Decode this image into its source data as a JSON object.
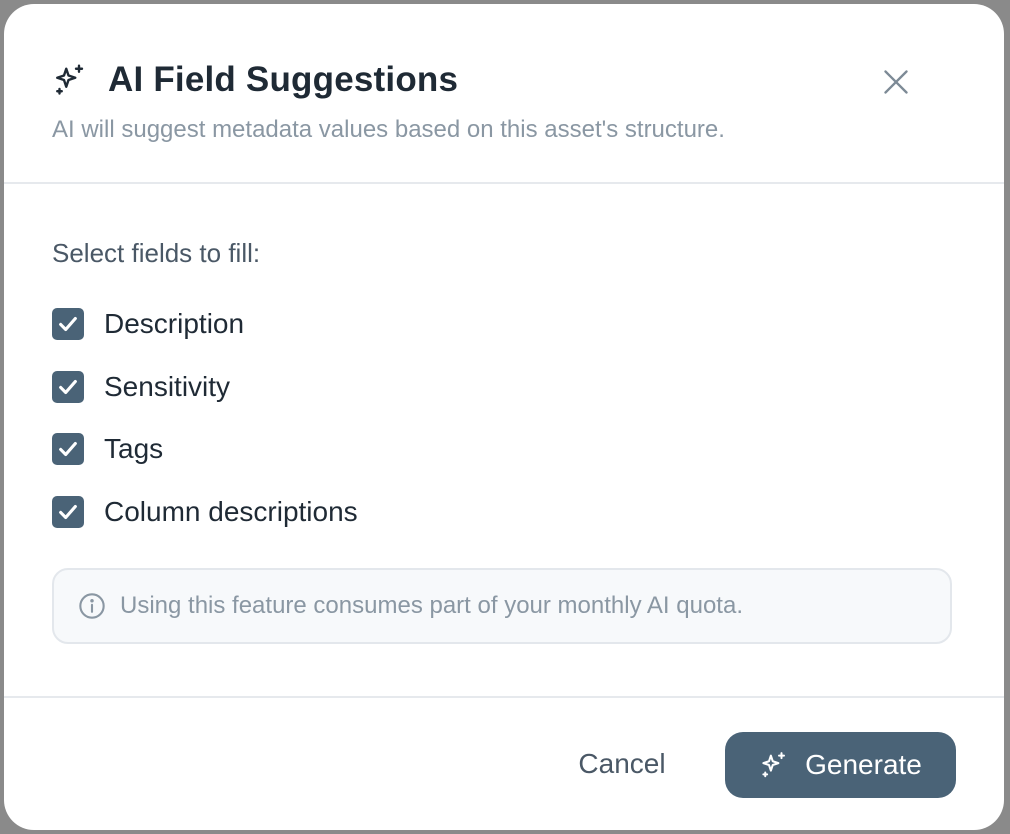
{
  "dialog": {
    "title": "AI Field Suggestions",
    "subtitle": "AI will suggest metadata values based on this asset's structure.",
    "close_icon": "close-icon",
    "title_icon": "sparkles-icon"
  },
  "body": {
    "select_label": "Select fields to fill:",
    "fields": [
      {
        "label": "Description",
        "checked": true
      },
      {
        "label": "Sensitivity",
        "checked": true
      },
      {
        "label": "Tags",
        "checked": true
      },
      {
        "label": "Column descriptions",
        "checked": true
      }
    ],
    "notice": {
      "icon": "info-icon",
      "text": "Using this feature consumes part of your monthly AI quota."
    }
  },
  "footer": {
    "cancel_label": "Cancel",
    "generate_label": "Generate",
    "generate_icon": "sparkles-icon"
  },
  "colors": {
    "accent": "#4a6377",
    "title_text": "#1f2a35",
    "muted_text": "#8a97a3"
  }
}
